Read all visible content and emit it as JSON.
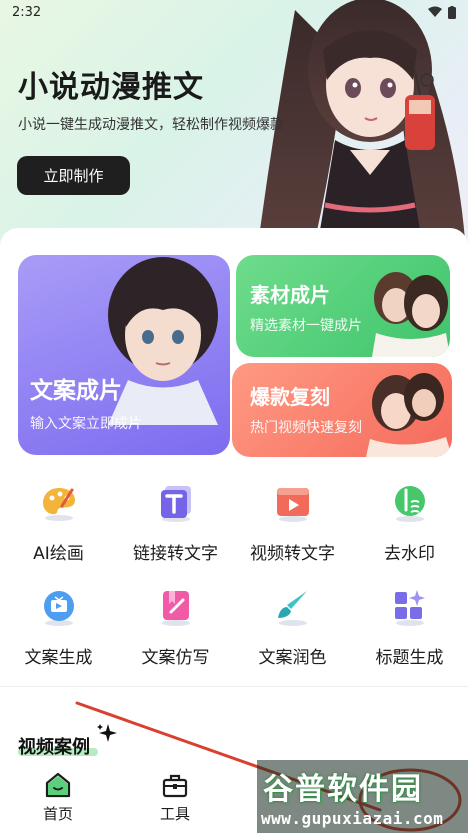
{
  "status_bar": {
    "time": "2:32"
  },
  "hero": {
    "title": "小说动漫推文",
    "subtitle": "小说一键生成动漫推文，轻松制作视频爆款",
    "button_label": "立即制作"
  },
  "cards": {
    "main": {
      "title": "文案成片",
      "subtitle": "输入文案立即成片"
    },
    "material": {
      "title": "素材成片",
      "subtitle": "精选素材一键成片"
    },
    "copy": {
      "title": "爆款复刻",
      "subtitle": "热门视频快速复刻"
    }
  },
  "tools": [
    {
      "label": "AI绘画",
      "icon": "palette-icon"
    },
    {
      "label": "链接转文字",
      "icon": "text-t-icon"
    },
    {
      "label": "视频转文字",
      "icon": "video-play-icon"
    },
    {
      "label": "去水印",
      "icon": "watermark-remove-icon"
    },
    {
      "label": "文案生成",
      "icon": "tv-icon"
    },
    {
      "label": "文案仿写",
      "icon": "bookmark-edit-icon"
    },
    {
      "label": "文案润色",
      "icon": "brush-icon"
    },
    {
      "label": "标题生成",
      "icon": "grid-sparkle-icon"
    }
  ],
  "section": {
    "title": "视频案例"
  },
  "bottom_nav": [
    {
      "label": "首页",
      "icon": "home-icon"
    },
    {
      "label": "工具",
      "icon": "toolbox-icon"
    }
  ],
  "watermark": {
    "title": "谷普软件园",
    "url": "www.gupuxiazai.com"
  },
  "colors": {
    "purple_card": "#7d6cf0",
    "green_card": "#3ec46b",
    "red_card": "#f56a5b",
    "hero_button": "#1f1f1f",
    "annotation_line": "#d9402f"
  }
}
